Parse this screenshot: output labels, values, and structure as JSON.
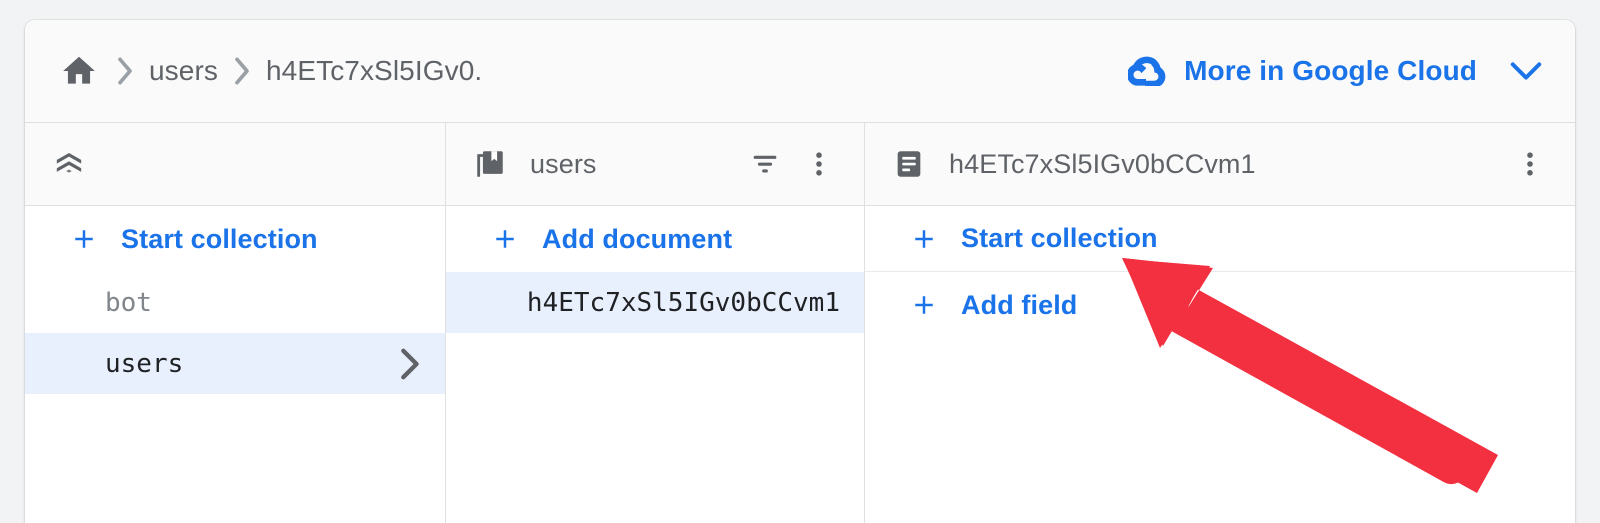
{
  "breadcrumb": {
    "home_icon": "home-icon",
    "separator_icon": "chevron-right-icon",
    "items": [
      {
        "label": "users"
      },
      {
        "label": "h4ETc7xSl5IGv0."
      }
    ]
  },
  "cloud_link": {
    "label": "More in Google Cloud",
    "icon": "google-cloud-icon",
    "chevron_icon": "chevron-down-icon"
  },
  "columns": [
    {
      "header": {
        "icon": "firestore-root-icon",
        "title": ""
      },
      "actions": [
        {
          "label": "Start collection",
          "icon": "plus-icon"
        }
      ],
      "rows": [
        {
          "label": "bot",
          "selected": false,
          "has_chevron": false
        },
        {
          "label": "users",
          "selected": true,
          "has_chevron": true
        }
      ]
    },
    {
      "header": {
        "icon": "collection-icon",
        "title": "users",
        "actions": [
          {
            "icon": "filter-icon",
            "name": "filter-button"
          },
          {
            "icon": "more-vert-icon",
            "name": "more-options-button"
          }
        ]
      },
      "actions": [
        {
          "label": "Add document",
          "icon": "plus-icon"
        }
      ],
      "rows": [
        {
          "label": "h4ETc7xSl5IGv0bCCvm1",
          "selected": true,
          "has_chevron": false
        }
      ]
    },
    {
      "header": {
        "icon": "document-icon",
        "title": "h4ETc7xSl5IGv0bCCvm1",
        "actions": [
          {
            "icon": "more-vert-icon",
            "name": "more-options-button"
          }
        ]
      },
      "actions": [
        {
          "label": "Start collection",
          "icon": "plus-icon"
        },
        {
          "label": "Add field",
          "icon": "plus-icon"
        }
      ],
      "rows": []
    }
  ],
  "annotation": {
    "type": "arrow",
    "color": "#f23040",
    "points_to": "Start collection"
  },
  "colors": {
    "accent_blue": "#1a73e8",
    "selected_row_bg": "#e8f0fe",
    "text_gray": "#5f6368",
    "header_bg": "#fafafa",
    "page_bg": "#f1f3f4",
    "annotation_red": "#f23040"
  }
}
